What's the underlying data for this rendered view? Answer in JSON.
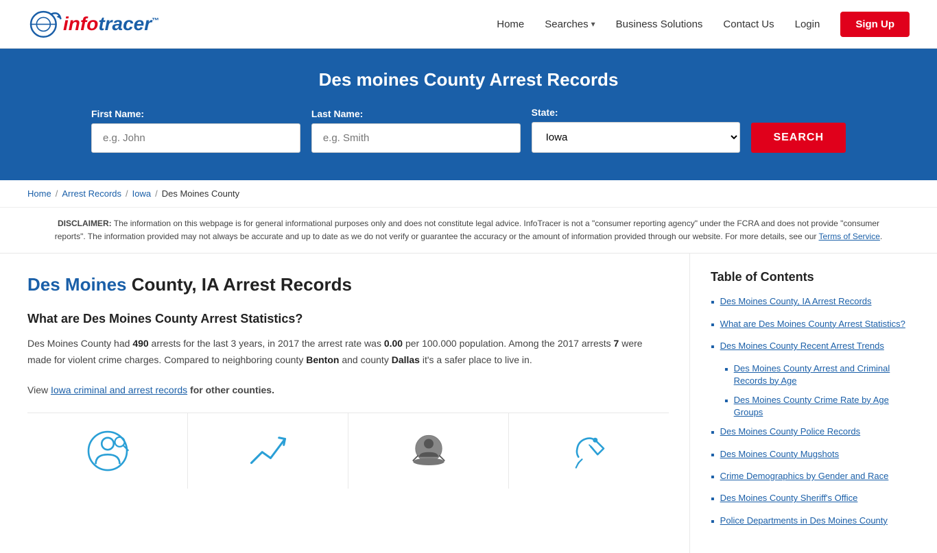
{
  "header": {
    "logo_info": "info",
    "logo_tracer": "tracer",
    "logo_tm": "™",
    "nav": {
      "home": "Home",
      "searches": "Searches",
      "business_solutions": "Business Solutions",
      "contact_us": "Contact Us",
      "login": "Login",
      "signup": "Sign Up"
    }
  },
  "hero": {
    "title": "Des moines County Arrest Records",
    "first_name_label": "First Name:",
    "first_name_placeholder": "e.g. John",
    "last_name_label": "Last Name:",
    "last_name_placeholder": "e.g. Smith",
    "state_label": "State:",
    "state_value": "Iowa",
    "search_button": "SEARCH"
  },
  "breadcrumb": {
    "home": "Home",
    "arrest_records": "Arrest Records",
    "iowa": "Iowa",
    "current": "Des Moines County"
  },
  "disclaimer": {
    "label": "DISCLAIMER:",
    "text": "The information on this webpage is for general informational purposes only and does not constitute legal advice. InfoTracer is not a \"consumer reporting agency\" under the FCRA and does not provide \"consumer reports\". The information provided may not always be accurate and up to date as we do not verify or guarantee the accuracy or the amount of information provided through our website. For more details, see our",
    "link_text": "Terms of Service",
    "period": "."
  },
  "article": {
    "title_highlight": "Des Moines",
    "title_rest": " County, IA Arrest Records",
    "stats_heading": "What are Des Moines County Arrest Statistics?",
    "stats_body_1": "Des Moines County had ",
    "arrests_count": "490",
    "stats_body_2": " arrests for the last 3 years, in 2017 the arrest rate was ",
    "arrest_rate": "0.00",
    "stats_body_3": " per 100.000 population. Among the 2017 arrests ",
    "violent_count": "7",
    "stats_body_4": " were made for violent crime charges. Compared to neighboring county ",
    "county1": "Benton",
    "stats_body_5": " and county ",
    "county2": "Dallas",
    "stats_body_6": " it's a safer place to live in.",
    "view_text_prefix": "View ",
    "view_link_text": "Iowa criminal and arrest records",
    "view_text_suffix": " for other counties."
  },
  "toc": {
    "title": "Table of Contents",
    "items": [
      {
        "text": "Des Moines County, IA Arrest Records",
        "sub": false
      },
      {
        "text": "What are Des Moines County Arrest Statistics?",
        "sub": false
      },
      {
        "text": "Des Moines County Recent Arrest Trends",
        "sub": false
      },
      {
        "text": "Des Moines County Arrest and Criminal Records by Age",
        "sub": true
      },
      {
        "text": "Des Moines County Crime Rate by Age Groups",
        "sub": true
      },
      {
        "text": "Des Moines County Police Records",
        "sub": false
      },
      {
        "text": "Des Moines County Mugshots",
        "sub": false
      },
      {
        "text": "Crime Demographics by Gender and Race",
        "sub": false
      },
      {
        "text": "Des Moines County Sheriff's Office",
        "sub": false
      },
      {
        "text": "Police Departments in Des Moines County",
        "sub": false
      }
    ]
  }
}
